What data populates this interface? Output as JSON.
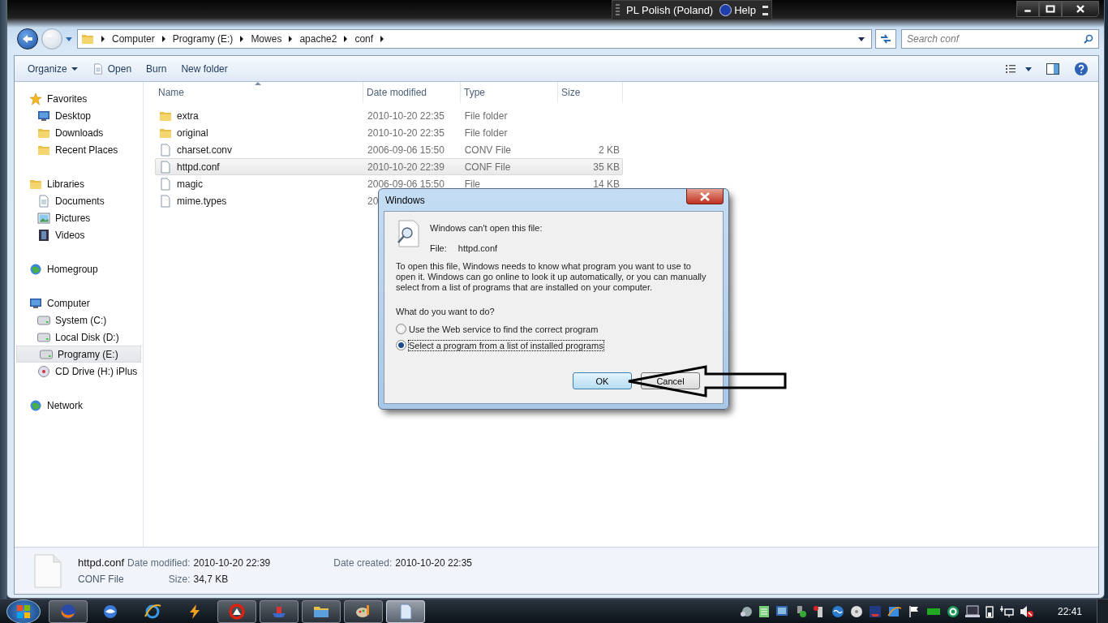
{
  "language_bar": {
    "language": "PL Polish (Poland)",
    "help": "Help"
  },
  "address_bar": {
    "crumbs": [
      "Computer",
      "Programy (E:)",
      "Mowes",
      "apache2",
      "conf"
    ]
  },
  "search": {
    "placeholder": "Search conf"
  },
  "toolbar": {
    "buttons": [
      {
        "label": "Organize",
        "kind": "menu"
      },
      {
        "label": "Open",
        "kind": "open"
      },
      {
        "label": "Burn",
        "kind": "plain"
      },
      {
        "label": "New folder",
        "kind": "plain"
      }
    ]
  },
  "sidebar": {
    "groups": [
      {
        "label": "Favorites",
        "kind": "star",
        "selected": false,
        "children": [
          {
            "label": "Desktop",
            "kind": "monitor",
            "selected": false
          },
          {
            "label": "Downloads",
            "kind": "folder",
            "selected": false
          },
          {
            "label": "Recent Places",
            "kind": "folder",
            "selected": false
          }
        ]
      },
      {
        "label": "Libraries",
        "kind": "folder",
        "selected": false,
        "children": [
          {
            "label": "Documents",
            "kind": "document",
            "selected": false
          },
          {
            "label": "Pictures",
            "kind": "picture",
            "selected": false
          },
          {
            "label": "Videos",
            "kind": "film",
            "selected": false
          }
        ]
      },
      {
        "label": "Homegroup",
        "kind": "globe",
        "selected": false
      },
      {
        "label": "Computer",
        "kind": "monitor",
        "selected": false,
        "children": [
          {
            "label": "System (C:)",
            "kind": "drive",
            "selected": false
          },
          {
            "label": "Local Disk (D:)",
            "kind": "drive",
            "selected": false
          },
          {
            "label": "Programy (E:)",
            "kind": "drive",
            "selected": true
          },
          {
            "label": "CD Drive (H:) iPlus",
            "kind": "disc",
            "selected": false
          }
        ]
      },
      {
        "label": "Network",
        "kind": "globe",
        "selected": false
      }
    ]
  },
  "files": {
    "columns": [
      "Name",
      "Date modified",
      "Type",
      "Size"
    ],
    "rows": [
      {
        "name": "extra",
        "kind": "folder",
        "date": "2010-10-20 22:35",
        "type": "File folder",
        "selected": false
      },
      {
        "name": "original",
        "kind": "folder",
        "date": "2010-10-20 22:35",
        "type": "File folder",
        "selected": false
      },
      {
        "name": "charset.conv",
        "kind": "file",
        "date": "2006-09-06 15:50",
        "type": "CONV File",
        "size": "2 KB",
        "selected": false
      },
      {
        "name": "httpd.conf",
        "kind": "file",
        "date": "2010-10-20 22:39",
        "type": "CONF File",
        "size": "35 KB",
        "selected": true
      },
      {
        "name": "magic",
        "kind": "file",
        "date": "2006-09-06 15:50",
        "type": "File",
        "size": "14 KB",
        "selected": false
      },
      {
        "name": "mime.types",
        "kind": "file",
        "date": "20",
        "selected": false
      }
    ]
  },
  "details": {
    "name": "httpd.conf",
    "type": "CONF File",
    "fields": [
      {
        "label": "Date modified:",
        "value": "2010-10-20 22:39"
      },
      {
        "label": "Size:",
        "value": "34,7 KB"
      },
      {
        "label": "Date created:",
        "value": "2010-10-20 22:35"
      }
    ]
  },
  "dialog": {
    "title": "Windows",
    "heading": "Windows can't open this file:",
    "file_label": "File:",
    "file_name": "httpd.conf",
    "body": "To open this file, Windows needs to know what program you want to use to open it. Windows can go online to look it up automatically, or you can manually select from a list of programs that are installed on your computer.",
    "question": "What do you want to do?",
    "options": [
      {
        "label": "Use the Web service to find the correct program",
        "selected": false
      },
      {
        "label": "Select a program from a list of installed programs",
        "selected": true
      }
    ],
    "buttons": [
      {
        "label": "OK",
        "default": true
      },
      {
        "label": "Cancel",
        "default": false
      }
    ]
  },
  "taskbar": {
    "apps": [
      {
        "kind": "fox",
        "running": true,
        "active": false
      },
      {
        "kind": "bird",
        "running": false,
        "active": false
      },
      {
        "kind": "ie",
        "running": false,
        "active": false
      },
      {
        "kind": "bolt",
        "running": false,
        "active": false
      },
      {
        "kind": "red",
        "running": true,
        "active": false
      },
      {
        "kind": "ship",
        "running": true,
        "active": false
      },
      {
        "kind": "folder",
        "running": true,
        "active": false
      },
      {
        "kind": "palette",
        "running": true,
        "active": false
      },
      {
        "kind": "document",
        "running": true,
        "active": true
      }
    ],
    "clock": "22:41"
  }
}
